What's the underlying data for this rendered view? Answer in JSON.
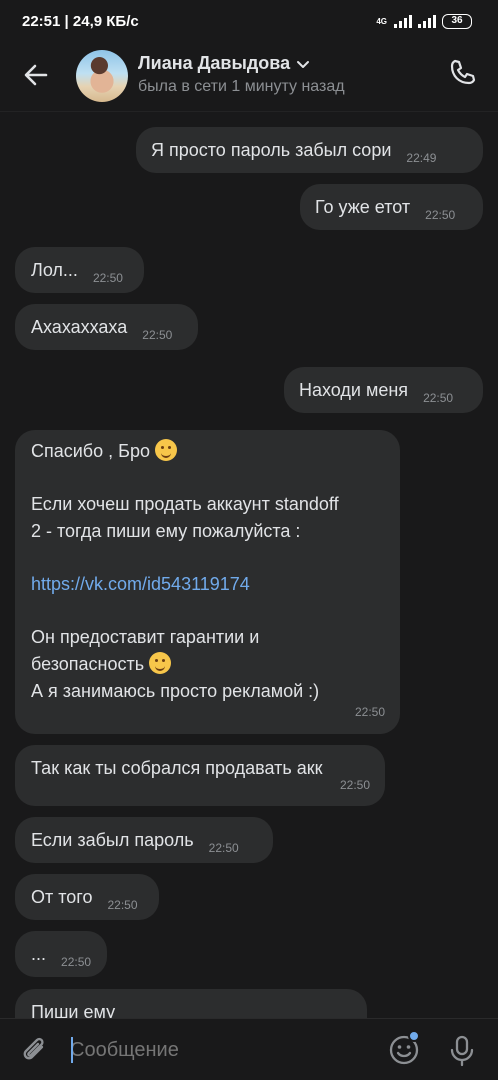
{
  "status_bar": {
    "time_speed": "22:51 | 24,9 КБ/с",
    "network": "4G",
    "battery": "36"
  },
  "header": {
    "name": "Лиана Давыдова",
    "status": "была в сети 1 минуту назад"
  },
  "messages": [
    {
      "text": "Я просто пароль забыл сори",
      "time": "22:49"
    },
    {
      "text": "Го уже етот",
      "time": "22:50"
    },
    {
      "text": "Лол...",
      "time": "22:50"
    },
    {
      "text": "Ахахаххаха",
      "time": "22:50"
    },
    {
      "text": "Находи меня",
      "time": "22:50"
    },
    {
      "line1": "Спасибо , Бро",
      "line2": "Если хочеш продать аккаунт standoff",
      "line3": "2 - тогда пиши ему пожалуйста :",
      "link": "https://vk.com/id543119174",
      "line4": "Он предоставит гарантии и",
      "line5": "безопасность",
      "line6": "А я занимаюсь просто рекламой :)",
      "time": "22:50"
    },
    {
      "text": "Так как ты собрался продавать акк",
      "time": "22:50"
    },
    {
      "text": "Если забыл пароль",
      "time": "22:50"
    },
    {
      "text": "От того",
      "time": "22:50"
    },
    {
      "text": "...",
      "time": "22:50"
    },
    {
      "text": "Пиши ему"
    }
  ],
  "composer": {
    "placeholder": "Сообщение"
  }
}
